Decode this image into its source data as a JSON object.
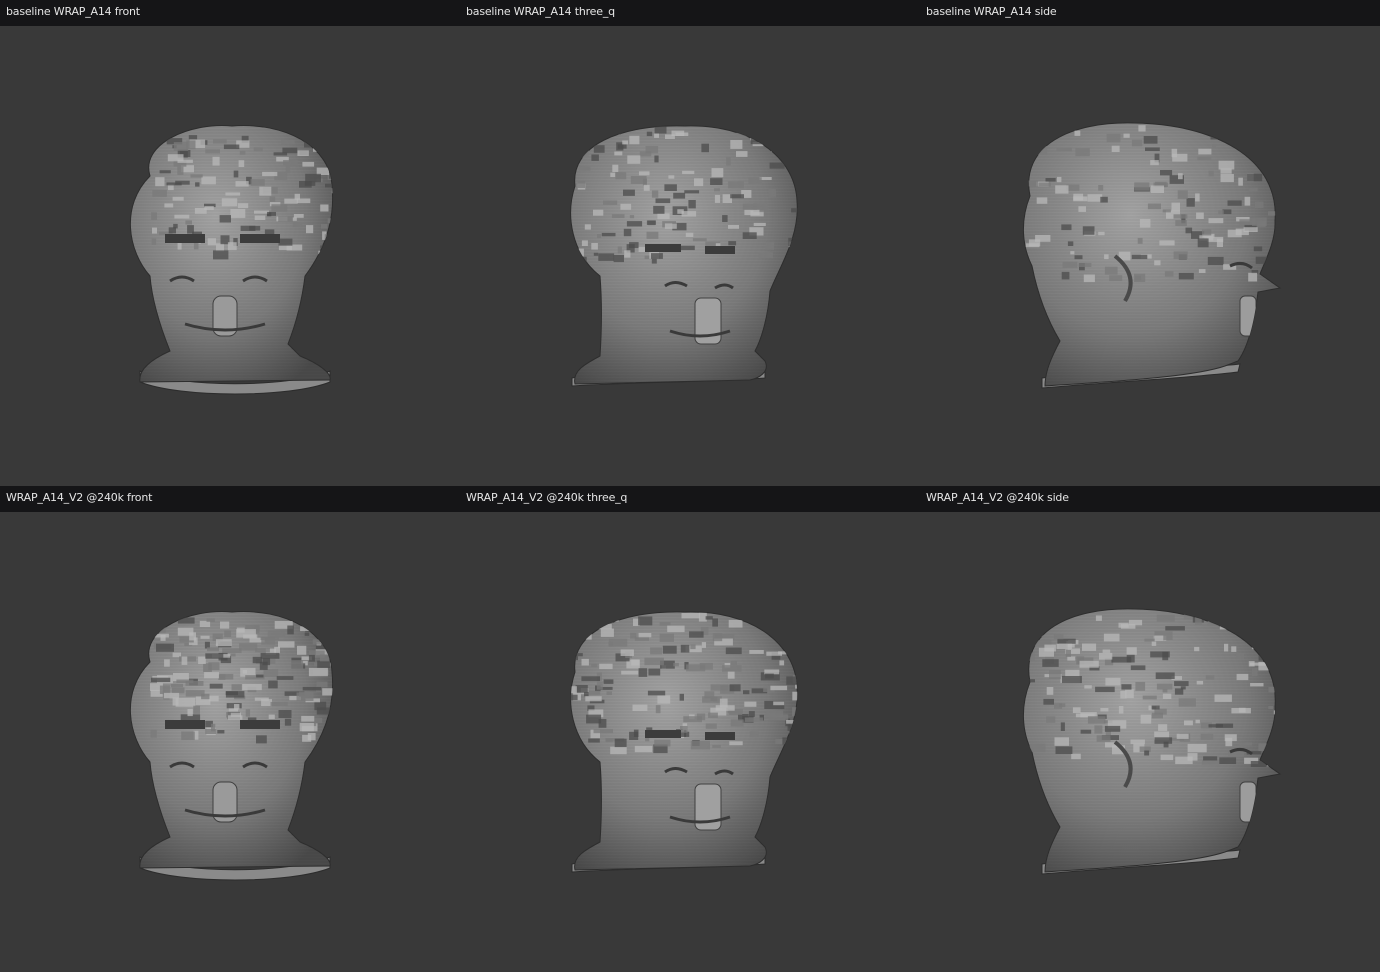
{
  "renders": [
    {
      "label": "baseline WRAP_A14 front",
      "model": "baseline",
      "view": "front"
    },
    {
      "label": "baseline WRAP_A14 three_q",
      "model": "baseline",
      "view": "three_q"
    },
    {
      "label": "baseline WRAP_A14 side",
      "model": "baseline",
      "view": "side"
    },
    {
      "label": "WRAP_A14_V2 @240k front",
      "model": "v2",
      "view": "front"
    },
    {
      "label": "WRAP_A14_V2 @240k three_q",
      "model": "v2",
      "view": "three_q"
    },
    {
      "label": "WRAP_A14_V2 @240k side",
      "model": "v2",
      "view": "side"
    }
  ],
  "colors": {
    "background": "#393939",
    "header_bar": "#151517",
    "label_text": "#e6e6e6",
    "mesh_light": "#a4a4a4",
    "mesh_mid": "#7c7c7c",
    "mesh_dark": "#4a4a4a"
  }
}
